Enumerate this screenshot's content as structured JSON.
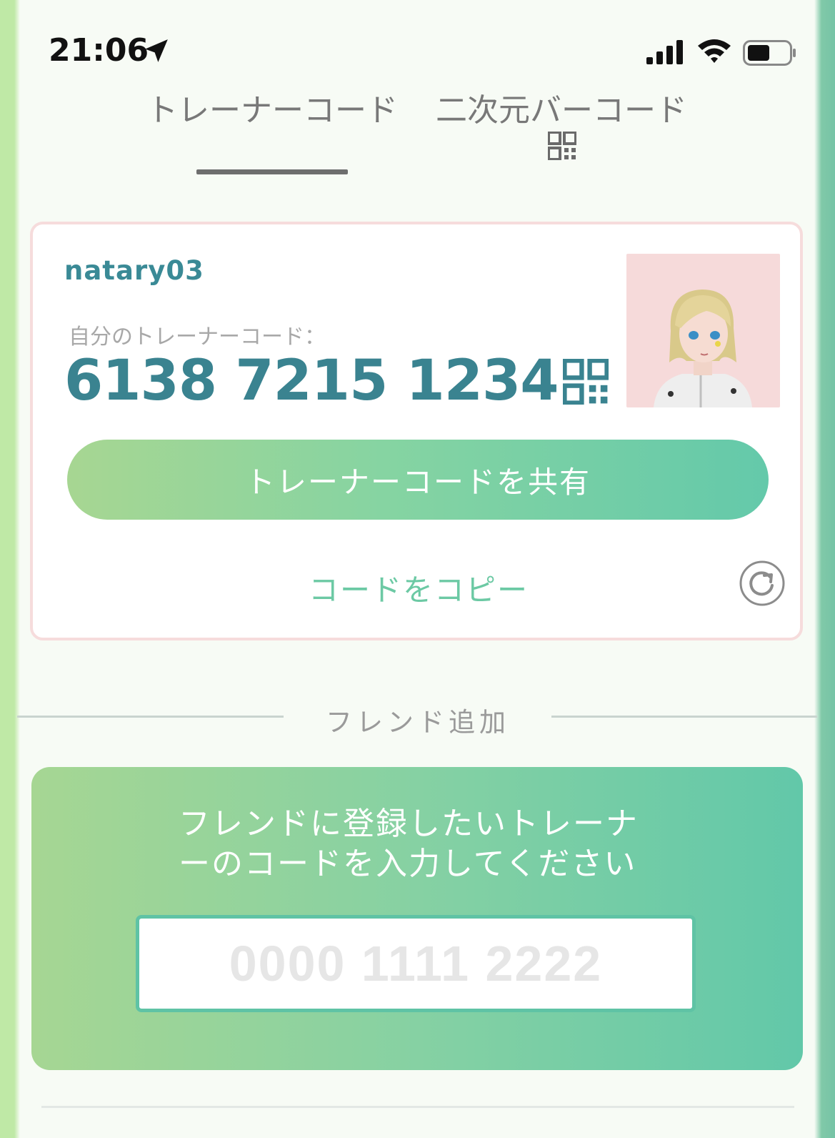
{
  "status_bar": {
    "time": "21:06",
    "icons": [
      "location-arrow-icon",
      "signal-bars-icon",
      "wifi-icon",
      "battery-icon"
    ]
  },
  "tabs": [
    {
      "label": "トレーナーコード",
      "active": true
    },
    {
      "label": "二次元バーコード",
      "active": false,
      "icon": "qr-code-icon"
    }
  ],
  "card": {
    "username": "natary03",
    "code_label": "自分のトレーナーコード：",
    "code_value": "6138 7215 1234",
    "share_button": "トレーナーコードを共有",
    "copy_link": "コードをコピー"
  },
  "friend_add": {
    "divider_label": "フレンド追加",
    "instruction": "フレンドに登録したいトレーナーのコードを入力してください",
    "input_placeholder": "0000 1111 2222",
    "input_value": ""
  },
  "colors": {
    "accent_teal": "#3a8390",
    "accent_green": "#6cc9a4",
    "card_border": "#f6dcdc",
    "avatar_bg": "#f6dada"
  }
}
